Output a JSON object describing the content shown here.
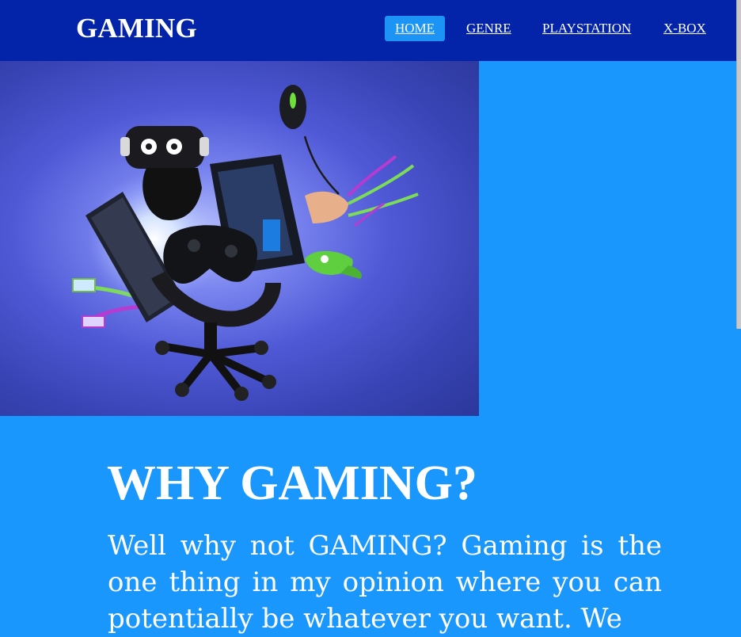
{
  "brand": {
    "logo_text": "GAMING"
  },
  "nav": {
    "items": [
      {
        "label": "HOME",
        "active": true
      },
      {
        "label": "GENRE",
        "active": false
      },
      {
        "label": "PLAYSTATION",
        "active": false
      },
      {
        "label": "X-BOX",
        "active": false
      }
    ]
  },
  "hero": {
    "image_subject": "dog wearing VR headset on office chair surrounded by gaming gear"
  },
  "content": {
    "heading": "WHY GAMING?",
    "body": "Well why not GAMING? Gaming is the one thing in my opinion where you can potentially be whatever you want. We"
  },
  "colors": {
    "navbar_bg": "#0323a8",
    "page_bg": "#1a97fc",
    "active_nav_bg": "#1b94f6",
    "text": "#ffffff"
  }
}
